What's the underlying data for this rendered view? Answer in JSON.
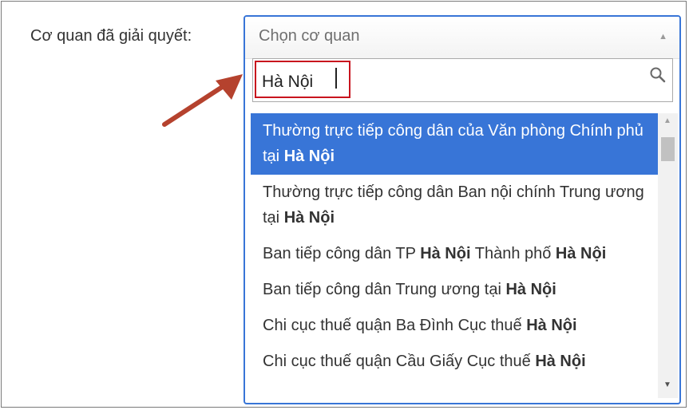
{
  "form": {
    "agency_label": "Cơ quan đã giải quyết:"
  },
  "select": {
    "placeholder": "Chọn cơ quan",
    "search": {
      "value": "Hà Nội"
    },
    "results": [
      {
        "segments": [
          {
            "t": "Thường trực tiếp công dân của Văn phòng Chính phủ tại ",
            "b": false
          },
          {
            "t": "Hà Nội",
            "b": true
          }
        ],
        "highlighted": true
      },
      {
        "segments": [
          {
            "t": "Thường trực tiếp công dân Ban nội chính Trung ương tại ",
            "b": false
          },
          {
            "t": "Hà Nội",
            "b": true
          }
        ],
        "highlighted": false
      },
      {
        "segments": [
          {
            "t": "Ban tiếp công dân TP ",
            "b": false
          },
          {
            "t": "Hà Nội",
            "b": true
          },
          {
            "t": " Thành phố ",
            "b": false
          },
          {
            "t": "Hà Nội",
            "b": true
          }
        ],
        "highlighted": false
      },
      {
        "segments": [
          {
            "t": "Ban tiếp công dân Trung ương tại ",
            "b": false
          },
          {
            "t": "Hà Nội",
            "b": true
          }
        ],
        "highlighted": false
      },
      {
        "segments": [
          {
            "t": "Chi cục thuế quận Ba Đình Cục thuế ",
            "b": false
          },
          {
            "t": "Hà Nội",
            "b": true
          }
        ],
        "highlighted": false
      },
      {
        "segments": [
          {
            "t": "Chi cục thuế quận Cầu Giấy Cục thuế ",
            "b": false
          },
          {
            "t": "Hà Nội",
            "b": true
          }
        ],
        "highlighted": false
      }
    ]
  },
  "colors": {
    "highlight": "#3875d7",
    "annotation_box": "#c8141e",
    "annotation_arrow": "#b5422e"
  },
  "icons": {
    "search": "search-icon",
    "dropdown": "chevron-up-icon",
    "pointer": "annotation-arrow-icon"
  }
}
